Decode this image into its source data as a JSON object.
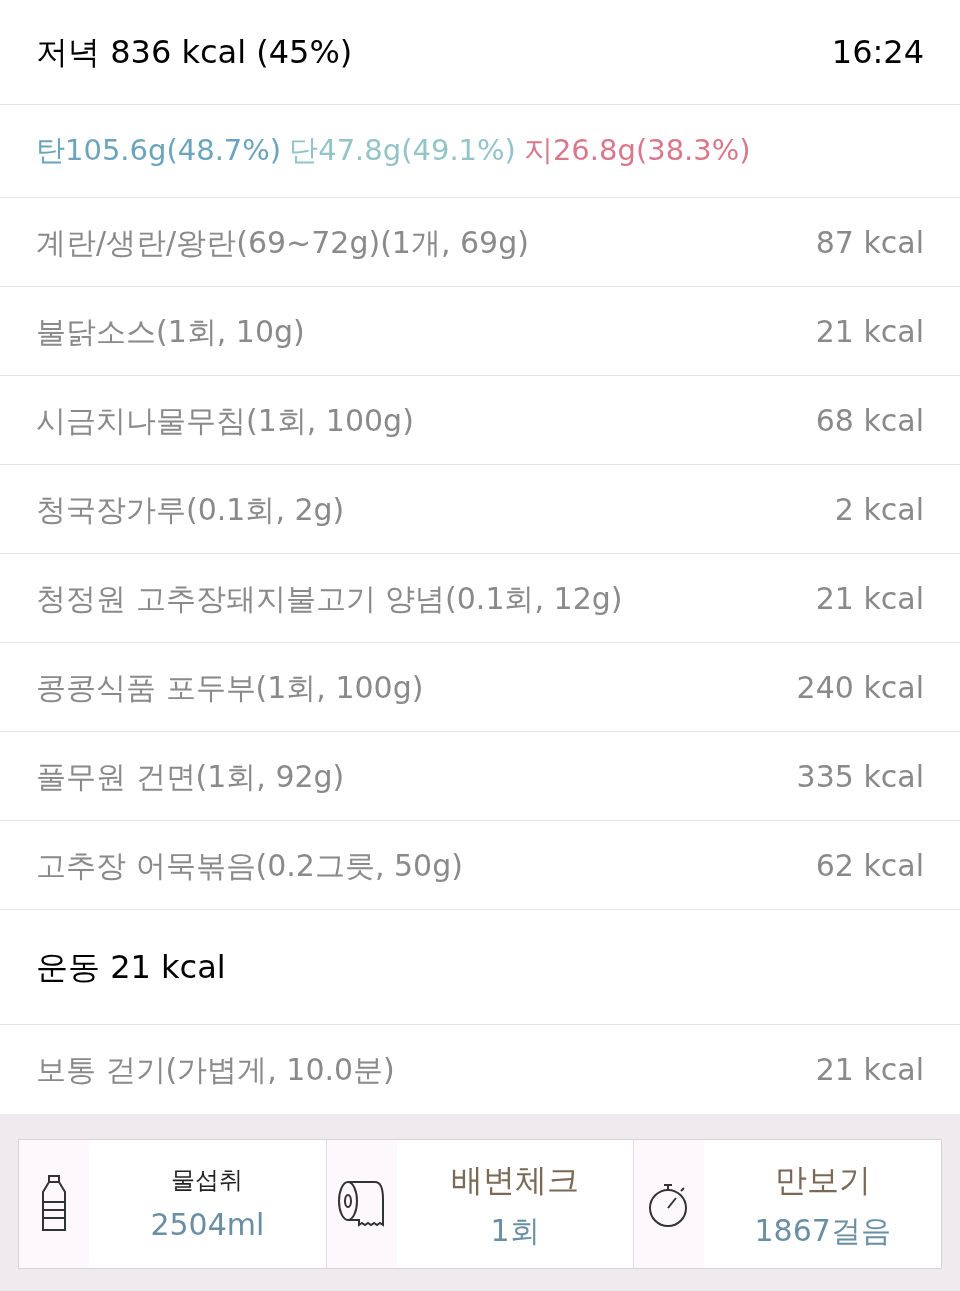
{
  "meal": {
    "title": "저녁 836 kcal (45%)",
    "time": "16:24"
  },
  "macros": [
    {
      "text": "탄105.6g(48.7%)",
      "color": "#6aa5bd"
    },
    {
      "text": "단47.8g(49.1%)",
      "color": "#93c4c8"
    },
    {
      "text": "지26.8g(38.3%)",
      "color": "#d9788c"
    }
  ],
  "foods": [
    {
      "name": "계란/생란/왕란(69~72g)(1개, 69g)",
      "kcal": "87 kcal"
    },
    {
      "name": "불닭소스(1회, 10g)",
      "kcal": "21 kcal"
    },
    {
      "name": "시금치나물무침(1회, 100g)",
      "kcal": "68 kcal"
    },
    {
      "name": "청국장가루(0.1회, 2g)",
      "kcal": "2 kcal"
    },
    {
      "name": "청정원 고추장돼지불고기 양념(0.1회, 12g)",
      "kcal": "21 kcal"
    },
    {
      "name": "콩콩식품 포두부(1회, 100g)",
      "kcal": "240 kcal"
    },
    {
      "name": "풀무원 건면(1회, 92g)",
      "kcal": "335 kcal"
    },
    {
      "name": "고추장 어묵볶음(0.2그릇, 50g)",
      "kcal": "62 kcal"
    }
  ],
  "exercise": {
    "title": "운동 21 kcal",
    "items": [
      {
        "name": "보통 걷기(가볍게, 10.0분)",
        "kcal": "21 kcal"
      }
    ]
  },
  "trackers": [
    {
      "kind": "water",
      "label": "물섭취",
      "value": "2504ml"
    },
    {
      "kind": "toilet",
      "label": "배변체크",
      "value": "1회"
    },
    {
      "kind": "steps",
      "label": "만보기",
      "value": "1867걸음"
    }
  ]
}
